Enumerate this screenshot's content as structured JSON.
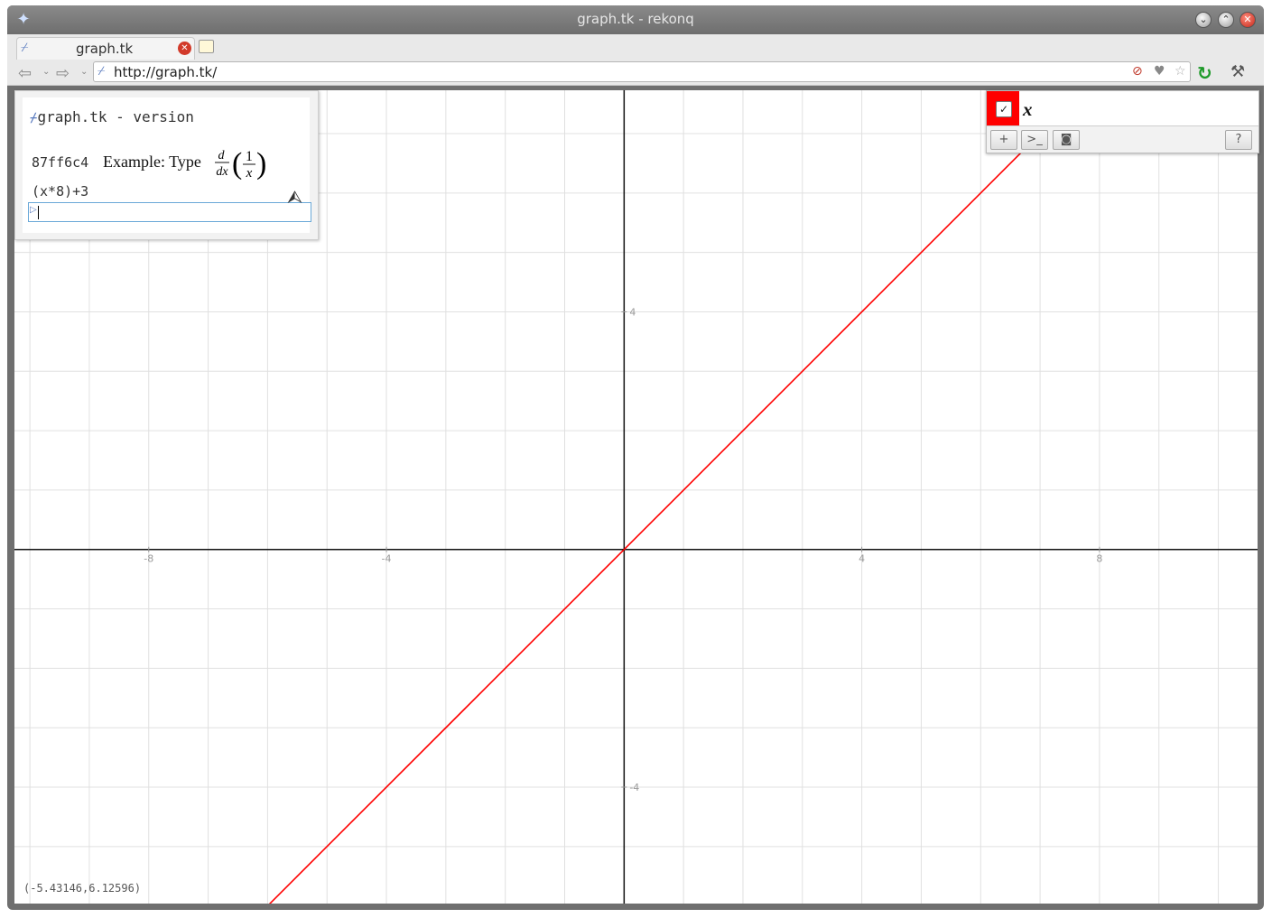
{
  "window": {
    "title": "graph.tk - rekonq",
    "app_icon": "rekonq-icon",
    "buttons": [
      "minimize",
      "maximize",
      "close"
    ]
  },
  "browser": {
    "tab": {
      "label": "graph.tk",
      "favicon": "graph-favicon-icon"
    },
    "url": "http://graph.tk/",
    "nav": {
      "back": "back-arrow-icon",
      "forward": "forward-arrow-icon"
    },
    "url_icons": [
      "adblock-icon",
      "heart-icon",
      "bookmark-star-icon"
    ]
  },
  "input_panel": {
    "title": "graph.tk - version",
    "version": "87ff6c4",
    "example_label": "Example: Type",
    "example_math": {
      "operator_num": "d",
      "operator_den": "dx",
      "frac_num": "1",
      "frac_den": "x"
    },
    "expression": "(x*8)+3",
    "input_value": ""
  },
  "function_panel": {
    "functions": [
      {
        "label": "x",
        "color": "#ff0000",
        "checked": true
      }
    ],
    "tools": [
      "add-icon",
      "console-icon",
      "camera-icon",
      "help-icon"
    ],
    "help_label": "?"
  },
  "coord_readout": "(-5.43146,6.12596)",
  "chart_data": {
    "type": "line",
    "series": [
      {
        "name": "x",
        "x": [
          -6,
          8
        ],
        "y": [
          -6,
          8
        ],
        "color": "#ff0000"
      }
    ],
    "x_ticks": [
      "-8",
      "-4",
      "4",
      "8"
    ],
    "y_ticks": [
      "4",
      "-4"
    ],
    "xlim": [
      -10.26,
      10.66
    ],
    "ylim": [
      -5.96,
      7.73
    ],
    "grid": true
  }
}
